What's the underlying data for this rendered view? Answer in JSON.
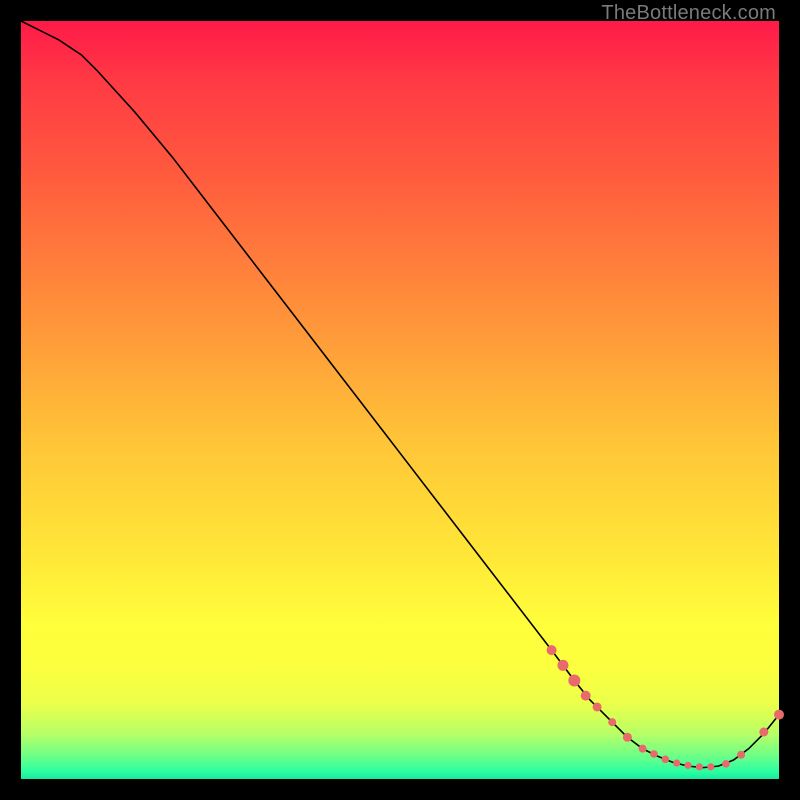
{
  "watermark": "TheBottleneck.com",
  "colors": {
    "background": "#000000",
    "curve": "#000000",
    "marker": "#e86a6a"
  },
  "chart_data": {
    "type": "line",
    "title": "",
    "xlabel": "",
    "ylabel": "",
    "xlim": [
      0,
      100
    ],
    "ylim": [
      0,
      100
    ],
    "grid": false,
    "legend": false,
    "series": [
      {
        "name": "bottleneck-curve",
        "x": [
          0,
          2,
          5,
          8,
          10,
          15,
          20,
          25,
          30,
          35,
          40,
          45,
          50,
          55,
          60,
          65,
          70,
          73,
          75,
          78,
          80,
          82,
          84,
          86,
          88,
          90,
          92,
          94,
          96,
          98,
          100
        ],
        "y": [
          100,
          99,
          97.5,
          95.5,
          93.5,
          88,
          82,
          75.5,
          69,
          62.5,
          56,
          49.5,
          43,
          36.5,
          30,
          23.5,
          17,
          13,
          10.5,
          7.5,
          5.5,
          4,
          3,
          2.2,
          1.7,
          1.5,
          1.7,
          2.5,
          4,
          6,
          8.5
        ]
      }
    ],
    "markers": {
      "name": "highlight-cluster",
      "points": [
        {
          "x": 70,
          "y": 17,
          "r": 5
        },
        {
          "x": 71.5,
          "y": 15,
          "r": 5.5
        },
        {
          "x": 73,
          "y": 13,
          "r": 6
        },
        {
          "x": 74.5,
          "y": 11,
          "r": 5
        },
        {
          "x": 76,
          "y": 9.5,
          "r": 4.5
        },
        {
          "x": 78,
          "y": 7.5,
          "r": 4
        },
        {
          "x": 80,
          "y": 5.5,
          "r": 4.5
        },
        {
          "x": 82,
          "y": 4,
          "r": 4
        },
        {
          "x": 83.5,
          "y": 3.3,
          "r": 3.8
        },
        {
          "x": 85,
          "y": 2.6,
          "r": 3.8
        },
        {
          "x": 86.5,
          "y": 2.1,
          "r": 3.6
        },
        {
          "x": 88,
          "y": 1.8,
          "r": 3.6
        },
        {
          "x": 89.5,
          "y": 1.6,
          "r": 3.6
        },
        {
          "x": 91,
          "y": 1.6,
          "r": 3.6
        },
        {
          "x": 93,
          "y": 2,
          "r": 3.8
        },
        {
          "x": 95,
          "y": 3.2,
          "r": 4
        },
        {
          "x": 98,
          "y": 6.2,
          "r": 4.5
        },
        {
          "x": 100,
          "y": 8.5,
          "r": 5
        }
      ]
    }
  }
}
